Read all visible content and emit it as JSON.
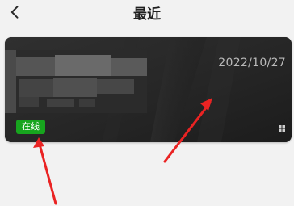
{
  "header": {
    "title": "最近",
    "back_icon": "chevron-left-icon"
  },
  "card": {
    "date": "2022/10/27",
    "status_badge": "在线",
    "status_color": "#17a51e",
    "os_icon": "windows-icon",
    "name_redacted": true
  }
}
